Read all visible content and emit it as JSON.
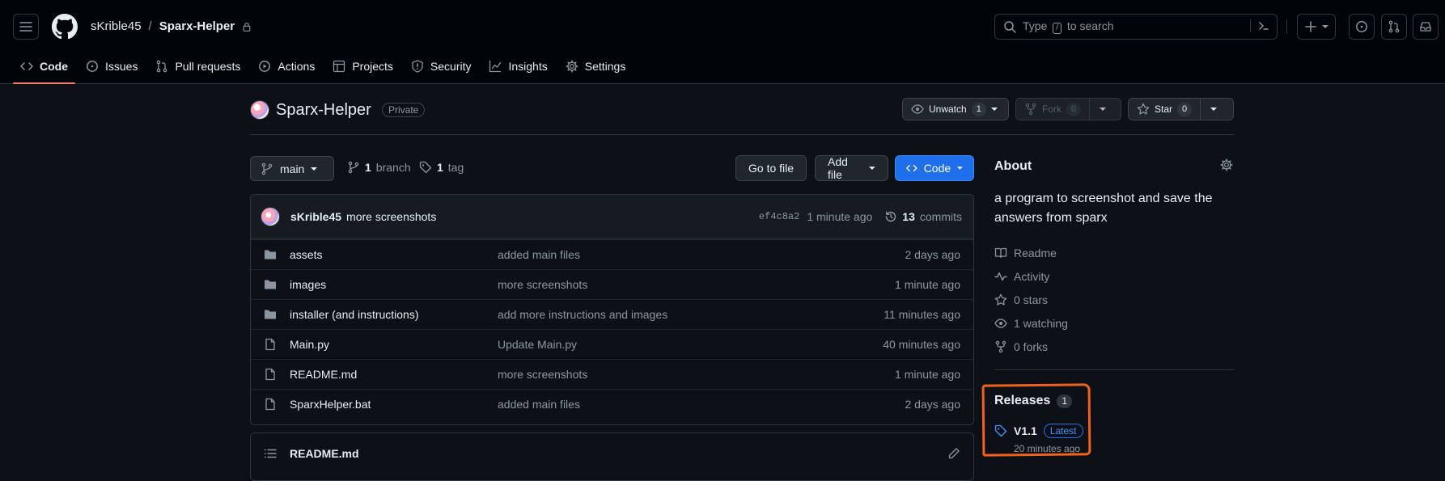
{
  "header": {
    "owner": "sKrible45",
    "separator": "/",
    "repo": "Sparx-Helper",
    "search_prefix": "Type",
    "search_slash": "/",
    "search_suffix": "to search"
  },
  "nav": [
    {
      "label": "Code",
      "icon": "code-icon",
      "active": true
    },
    {
      "label": "Issues",
      "icon": "issue-icon"
    },
    {
      "label": "Pull requests",
      "icon": "pull-request-icon"
    },
    {
      "label": "Actions",
      "icon": "play-icon"
    },
    {
      "label": "Projects",
      "icon": "table-icon"
    },
    {
      "label": "Security",
      "icon": "shield-icon"
    },
    {
      "label": "Insights",
      "icon": "graph-icon"
    },
    {
      "label": "Settings",
      "icon": "gear-icon"
    }
  ],
  "repo": {
    "title": "Sparx-Helper",
    "visibility": "Private",
    "unwatch_label": "Unwatch",
    "watch_count": "1",
    "fork_label": "Fork",
    "fork_count": "0",
    "star_label": "Star",
    "star_count": "0"
  },
  "branchbar": {
    "branch": "main",
    "branch_count": "1",
    "branch_label": "branch",
    "tag_count": "1",
    "tag_label": "tag",
    "go_to_file": "Go to file",
    "add_file": "Add file",
    "code": "Code"
  },
  "latest_commit": {
    "author": "sKrible45",
    "message": "more screenshots",
    "sha": "ef4c8a2",
    "time": "1 minute ago",
    "commit_count": "13",
    "commits_label": "commits"
  },
  "files": [
    {
      "name": "assets",
      "type": "folder",
      "commit": "added main files",
      "age": "2 days ago"
    },
    {
      "name": "images",
      "type": "folder",
      "commit": "more screenshots",
      "age": "1 minute ago"
    },
    {
      "name": "installer (and instructions)",
      "type": "folder",
      "commit": "add more instructions and images",
      "age": "11 minutes ago"
    },
    {
      "name": "Main.py",
      "type": "file",
      "commit": "Update Main.py",
      "age": "40 minutes ago"
    },
    {
      "name": "README.md",
      "type": "file",
      "commit": "more screenshots",
      "age": "1 minute ago"
    },
    {
      "name": "SparxHelper.bat",
      "type": "file",
      "commit": "added main files",
      "age": "2 days ago"
    }
  ],
  "readme": {
    "title": "README.md"
  },
  "about": {
    "title": "About",
    "description": "a program to screenshot and save the answers from sparx",
    "items": [
      {
        "label": "Readme",
        "icon": "book-icon"
      },
      {
        "label": "Activity",
        "icon": "pulse-icon"
      },
      {
        "label": "0 stars",
        "icon": "star-icon"
      },
      {
        "label": "1 watching",
        "icon": "eye-icon"
      },
      {
        "label": "0 forks",
        "icon": "fork-icon"
      }
    ]
  },
  "releases": {
    "title": "Releases",
    "count": "1",
    "name": "V1.1",
    "badge": "Latest",
    "time": "20 minutes ago"
  },
  "colors": {
    "background": "#0d1117",
    "header": "#010409",
    "accent_blue": "#1f6feb",
    "nav_underline": "#f78166",
    "annotation": "#f2611d"
  }
}
